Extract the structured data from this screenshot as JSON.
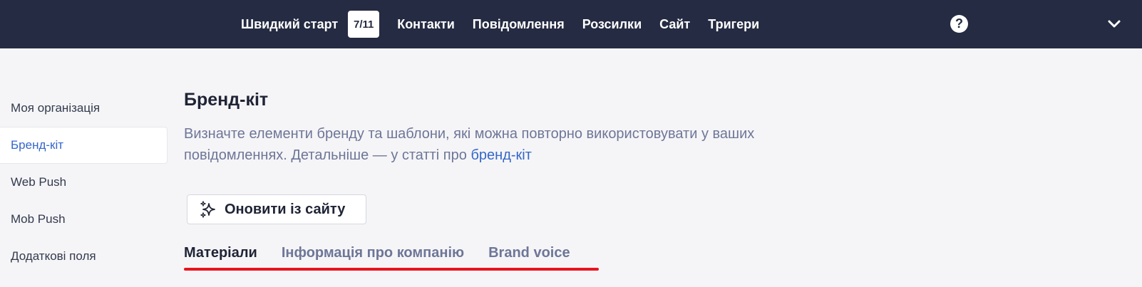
{
  "nav": {
    "quick_start": "Швидкий старт",
    "quick_start_progress": "7/11",
    "items": [
      "Контакти",
      "Повідомлення",
      "Розсилки",
      "Сайт",
      "Тригери"
    ],
    "help_icon": "?"
  },
  "sidebar": {
    "items": [
      {
        "label": "Моя організація",
        "active": false
      },
      {
        "label": "Бренд-кіт",
        "active": true
      },
      {
        "label": "Web Push",
        "active": false
      },
      {
        "label": "Mob Push",
        "active": false
      },
      {
        "label": "Додаткові поля",
        "active": false
      }
    ]
  },
  "main": {
    "title": "Бренд-кіт",
    "description_line1": "Визначте елементи бренду та шаблони, які можна повторно використовувати у ваших",
    "description_line2": "повідомленнях. Детальніше — у статті про ",
    "description_link": "бренд-кіт",
    "update_button": "Оновити із сайту"
  },
  "tabs": {
    "items": [
      "Матеріали",
      "Інформація про компанію",
      "Brand voice"
    ],
    "active_index": 0
  },
  "colors": {
    "topbar": "#252b42",
    "accent": "#3467c9",
    "underline": "#e8141e"
  }
}
